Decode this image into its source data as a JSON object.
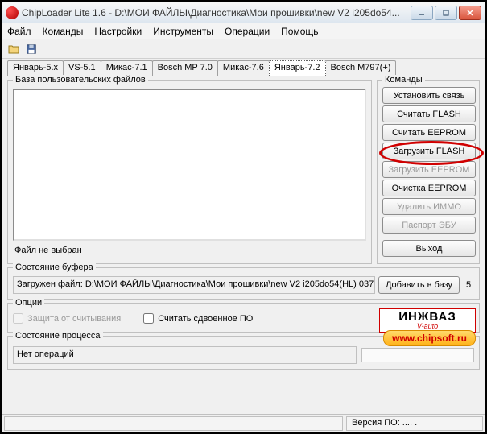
{
  "title": "ChipLoader Lite 1.6 - D:\\МОИ ФАЙЛЫ\\Диагностика\\Мои прошивки\\new V2  i205do54...",
  "menu": [
    "Файл",
    "Команды",
    "Настройки",
    "Инструменты",
    "Операции",
    "Помощь"
  ],
  "tabs": [
    "Январь-5.x",
    "VS-5.1",
    "Микас-7.1",
    "Bosch MP 7.0",
    "Микас-7.6",
    "Январь-7.2",
    "Bosch M797(+)"
  ],
  "active_tab_index": 5,
  "files": {
    "legend": "База пользовательских файлов",
    "status": "Файл не выбран"
  },
  "commands": {
    "legend": "Команды",
    "buttons": [
      {
        "label": "Установить связь",
        "enabled": true
      },
      {
        "label": "Считать FLASH",
        "enabled": true
      },
      {
        "label": "Считать EEPROM",
        "enabled": true
      },
      {
        "label": "Загрузить FLASH",
        "enabled": true,
        "highlight": true
      },
      {
        "label": "Загрузить EEPROM",
        "enabled": false
      },
      {
        "label": "Очистка EEPROM",
        "enabled": true
      },
      {
        "label": "Удалить ИММО",
        "enabled": false
      },
      {
        "label": "Паспорт ЭБУ",
        "enabled": false
      },
      {
        "label": "Выход",
        "enabled": true
      }
    ]
  },
  "buffer": {
    "legend": "Состояние буфера",
    "text": "Загружен файл: D:\\МОИ ФАЙЛЫ\\Диагностика\\Мои прошивки\\new V2  i205do54(HL) 037",
    "add_label": "Добавить в базу",
    "suffix": "5"
  },
  "options": {
    "legend": "Опции",
    "protect_label": "Защита от считывания",
    "protect_enabled": false,
    "dual_label": "Считать сдвоенное ПО"
  },
  "process": {
    "legend": "Состояние процесса",
    "text": "Нет операций"
  },
  "logos": {
    "inzhvaz_big": "ИНЖВАЗ",
    "inzhvaz_small": "V-auto",
    "chipsoft": "www.chipsoft.ru"
  },
  "statusbar": {
    "version": "Версия ПО:  .... ."
  }
}
